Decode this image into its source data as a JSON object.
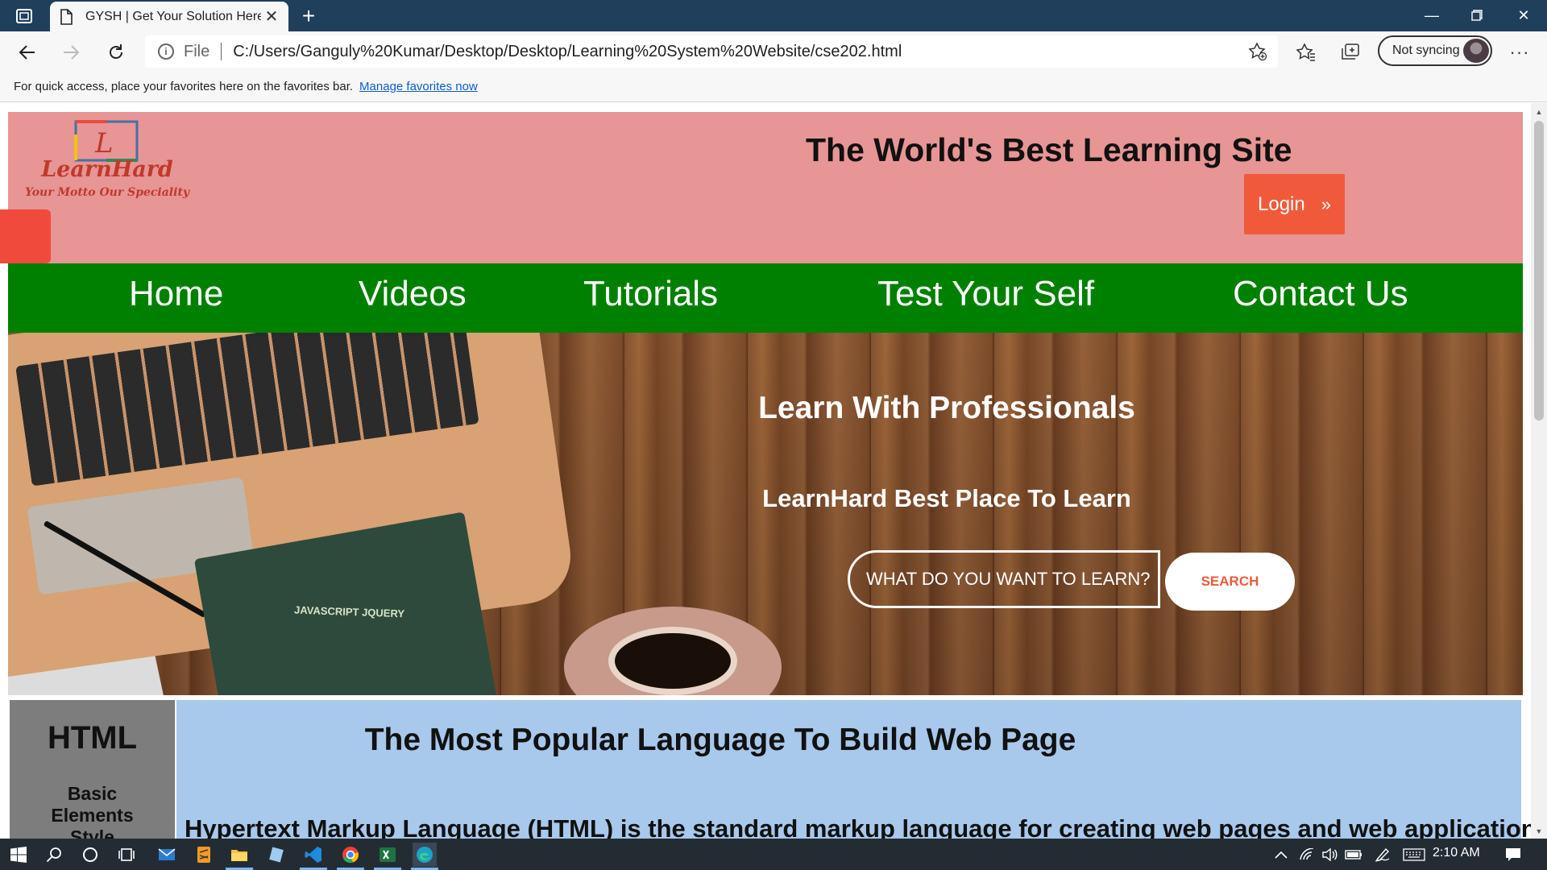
{
  "browser": {
    "tab_title": "GYSH | Get Your Solution Here!",
    "new_tab_symbol": "+",
    "address_scheme": "File",
    "address_url": "C:/Users/Ganguly%20Kumar/Desktop/Desktop/Learning%20System%20Website/cse202.html",
    "sync_label": "Not syncing",
    "more_symbol": "···",
    "favbar_text": "For quick access, place your favorites here on the favorites bar.",
    "favbar_link": "Manage favorites now"
  },
  "site": {
    "logo_name": "LearnHard",
    "logo_tagline": "Your Motto Our Speciality",
    "title": "The World's Best Learning Site",
    "login_label": "Login",
    "login_chevron": "»",
    "nav": [
      "Home",
      "Videos",
      "Tutorials",
      "Test Your Self",
      "Contact Us"
    ],
    "hero": {
      "title": "Learn With Professionals",
      "subtitle": "LearnHard Best Place To Learn",
      "search_placeholder": "WHAT DO YOU WANT TO LEARN?",
      "search_button": "SEARCH",
      "book_label": "JAVASCRIPT JQUERY"
    },
    "sidebar": {
      "title": "HTML",
      "links": [
        "Basic",
        "Elements",
        "Style"
      ]
    },
    "main": {
      "title": "The Most Popular Language To Build Web Page",
      "text": "Hypertext Markup Language (HTML) is the standard markup language for creating web pages and web applications."
    }
  },
  "taskbar": {
    "clock": "2:10 AM"
  },
  "colors": {
    "titlebar": "#1f3f5b",
    "header_bg": "#e79595",
    "nav_bg": "#008000",
    "login_bg": "#f05a3b",
    "sidebar_bg": "#7d7d7d",
    "main_bg": "#a8c8ec"
  }
}
